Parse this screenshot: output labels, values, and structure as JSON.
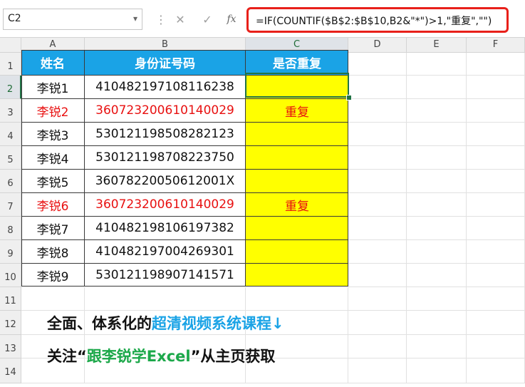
{
  "name_box": "C2",
  "formula": "=IF(COUNTIF($B$2:$B$10,B2&\"*\")>1,\"重复\",\"\")",
  "formula_buttons": {
    "cancel": "✕",
    "enter": "✓",
    "fx": "fx"
  },
  "columns": [
    "A",
    "B",
    "C",
    "D",
    "E",
    "F"
  ],
  "rows": [
    "1",
    "2",
    "3",
    "4",
    "5",
    "6",
    "7",
    "8",
    "9",
    "10",
    "11",
    "12",
    "13",
    "14"
  ],
  "table": {
    "headers": [
      "姓名",
      "身份证号码",
      "是否重复"
    ],
    "rows": [
      {
        "name": "李锐1",
        "id": "41048219710811623​8",
        "dup": ""
      },
      {
        "name": "李锐2",
        "id": "360723200610140029",
        "dup": "重复"
      },
      {
        "name": "李锐3",
        "id": "530121198508282123",
        "dup": ""
      },
      {
        "name": "李锐4",
        "id": "530121198708223750",
        "dup": ""
      },
      {
        "name": "李锐5",
        "id": "36078220050612001X",
        "dup": ""
      },
      {
        "name": "李锐6",
        "id": "360723200610140029",
        "dup": "重复"
      },
      {
        "name": "李锐7",
        "id": "410482198106197382",
        "dup": ""
      },
      {
        "name": "李锐8",
        "id": "410482197004269301",
        "dup": ""
      },
      {
        "name": "李锐9",
        "id": "530121198907141571",
        "dup": ""
      }
    ]
  },
  "promo": {
    "line1_a": "全面、体系化的",
    "line1_b": "超清视频系统课程↓",
    "line2_a": "关注“",
    "line2_b": "跟李锐学Excel",
    "line2_c": "”从主页获取"
  },
  "colors": {
    "header_blue": "#1aa3e6",
    "highlight_yellow": "#ffff00",
    "dup_red": "#e81010",
    "promo_green": "#1ca84a",
    "excel_green": "#217346"
  }
}
